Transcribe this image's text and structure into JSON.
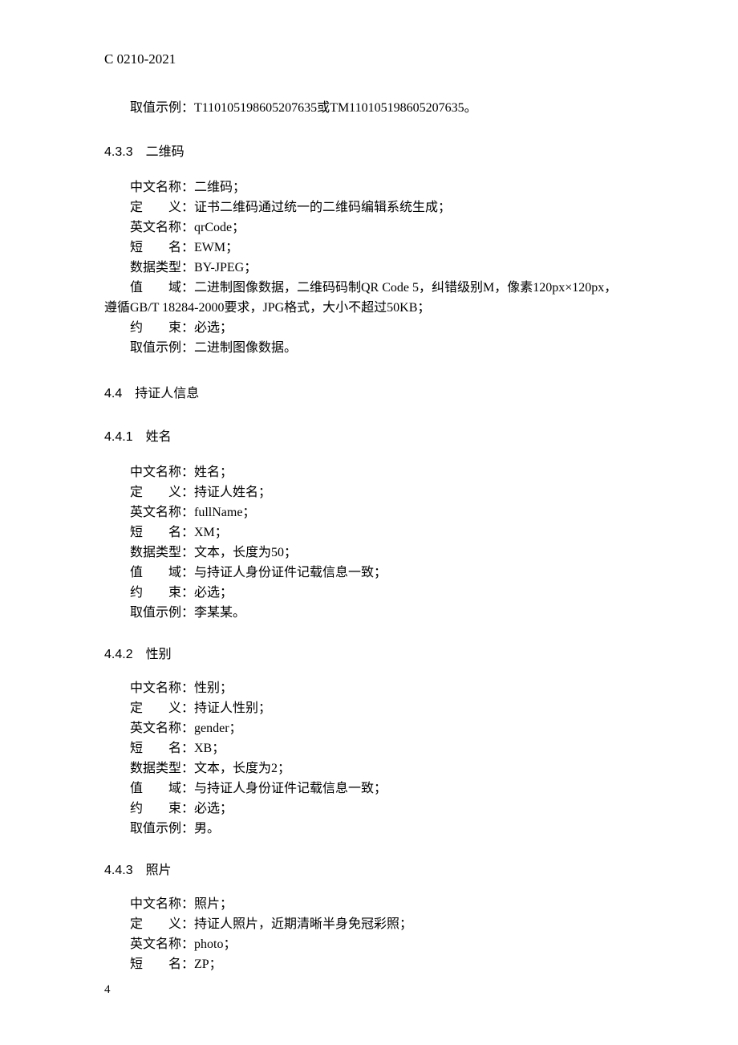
{
  "header": {
    "code": "C 0210-2021"
  },
  "intro": {
    "example_line": "取值示例：T110105198605207635或TM110105198605207635。"
  },
  "s433": {
    "heading": "4.3.3　二维码",
    "cn_name": "中文名称：二维码；",
    "definition": "定　　义：证书二维码通过统一的二维码编辑系统生成；",
    "en_name": "英文名称：qrCode；",
    "short_name": "短　　名：EWM；",
    "data_type": "数据类型：BY-JPEG；",
    "value_domain1": "值　　域：二进制图像数据，二维码码制QR Code 5，纠错级别M，像素120px×120px，",
    "value_domain2": "遵循GB/T 18284-2000要求，JPG格式，大小不超过50KB；",
    "constraint": "约　　束：必选；",
    "example": "取值示例：二进制图像数据。"
  },
  "s44": {
    "heading": "4.4　持证人信息"
  },
  "s441": {
    "heading": "4.4.1　姓名",
    "cn_name": "中文名称：姓名；",
    "definition": "定　　义：持证人姓名；",
    "en_name": "英文名称：fullName；",
    "short_name": "短　　名：XM；",
    "data_type": "数据类型：文本，长度为50；",
    "value_domain": "值　　域：与持证人身份证件记载信息一致；",
    "constraint": "约　　束：必选；",
    "example": "取值示例：李某某。"
  },
  "s442": {
    "heading": "4.4.2　性别",
    "cn_name": "中文名称：性别；",
    "definition": "定　　义：持证人性别；",
    "en_name": "英文名称：gender；",
    "short_name": "短　　名：XB；",
    "data_type": "数据类型：文本，长度为2；",
    "value_domain": "值　　域：与持证人身份证件记载信息一致；",
    "constraint": "约　　束：必选；",
    "example": "取值示例：男。"
  },
  "s443": {
    "heading": "4.4.3　照片",
    "cn_name": "中文名称：照片；",
    "definition": "定　　义：持证人照片，近期清晰半身免冠彩照；",
    "en_name": "英文名称：photo；",
    "short_name": "短　　名：ZP；"
  },
  "page_number": "4"
}
